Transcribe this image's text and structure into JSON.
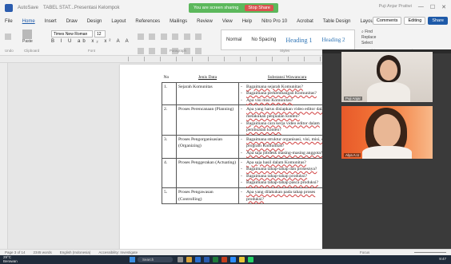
{
  "titlebar": {
    "autosave": "AutoSave",
    "doc_title": "TABEL STAT...Presentasi Kelompok",
    "share_status": "You are screen sharing",
    "stop_share": "Stop Share",
    "user_name": "Puji Anjar Pratiwi"
  },
  "menubar": {
    "items": [
      "File",
      "Home",
      "Insert",
      "Draw",
      "Design",
      "Layout",
      "References",
      "Mailings",
      "Review",
      "View",
      "Help",
      "Nitro Pro 10",
      "Acrobat",
      "Table Design",
      "Layout"
    ],
    "comments_label": "Comments",
    "editing_label": "Editing",
    "share_label": "Share"
  },
  "ribbon": {
    "paste_label": "Paste",
    "font_name": "Times New Roman",
    "font_size": "12",
    "format_row": "B I U ab x₂ x² A A",
    "styles": [
      "Normal",
      "No Spacing",
      "Heading 1",
      "Heading 2"
    ],
    "find_label": "Find",
    "replace_label": "Replace",
    "select_label": "Select",
    "group_labels": [
      "Undo",
      "Clipboard",
      "Font",
      "Paragraph",
      "Styles",
      "Editing",
      "Voice"
    ]
  },
  "document": {
    "table": {
      "headers": [
        "No",
        "Jenis Data",
        "Substansi Wawancara"
      ],
      "rows": [
        {
          "no": "1.",
          "category": "Sejarah Komunitas",
          "items": [
            "Bagaimana sejarah Komunitas?",
            "Bagaimana perkembangan Komunitas?",
            "Apa visi misi Komunitas?"
          ]
        },
        {
          "no": "2.",
          "category": "Proses Perencanaan (Planning)",
          "items": [
            "Apa yang harus disiapkan video editor dalam melakukan penjualan konten?",
            "Bagaimana cara kerja video editor dalam pembuatan konten?"
          ]
        },
        {
          "no": "3.",
          "category": "Proses Pengorganisasian (Organizing)",
          "items": [
            "Bagaimana struktur organisasi, visi, misi, dan program Komunitas?",
            "Apa saja jobdesk masing-masing anggota?"
          ]
        },
        {
          "no": "4.",
          "category": "Proses Penggerakan (Actuating)",
          "items": [
            "Apa saja hasil dalam Komunitas?",
            "Bagaimana tahap-tahap dan prosesnya?",
            "Bagaimana tahap-tahap produksi?",
            "Bagaimana tahap-tahap pasca produksi?"
          ]
        },
        {
          "no": "5.",
          "category": "Proses Pengawasan (Controlling)",
          "items": [
            "Apa yang dilakukan pada tahap proses produksi?"
          ]
        }
      ]
    }
  },
  "statusbar": {
    "page": "Page 3 of 14",
    "words": "2345 words",
    "language": "English (Indonesia)",
    "accessibility": "Accessibility: Investigate",
    "focus": "Focus"
  },
  "video": {
    "participant1": "Puji Anjar",
    "participant2": "Alya A.U"
  },
  "taskbar": {
    "weather_temp": "29°C",
    "weather_desc": "Berawan",
    "search_label": "Search",
    "time": "9:47"
  },
  "colors": {
    "word_blue": "#2b5cae",
    "share_green": "#5cb85c",
    "stop_red": "#d9534f",
    "taskbar": "#1f2b3a"
  }
}
